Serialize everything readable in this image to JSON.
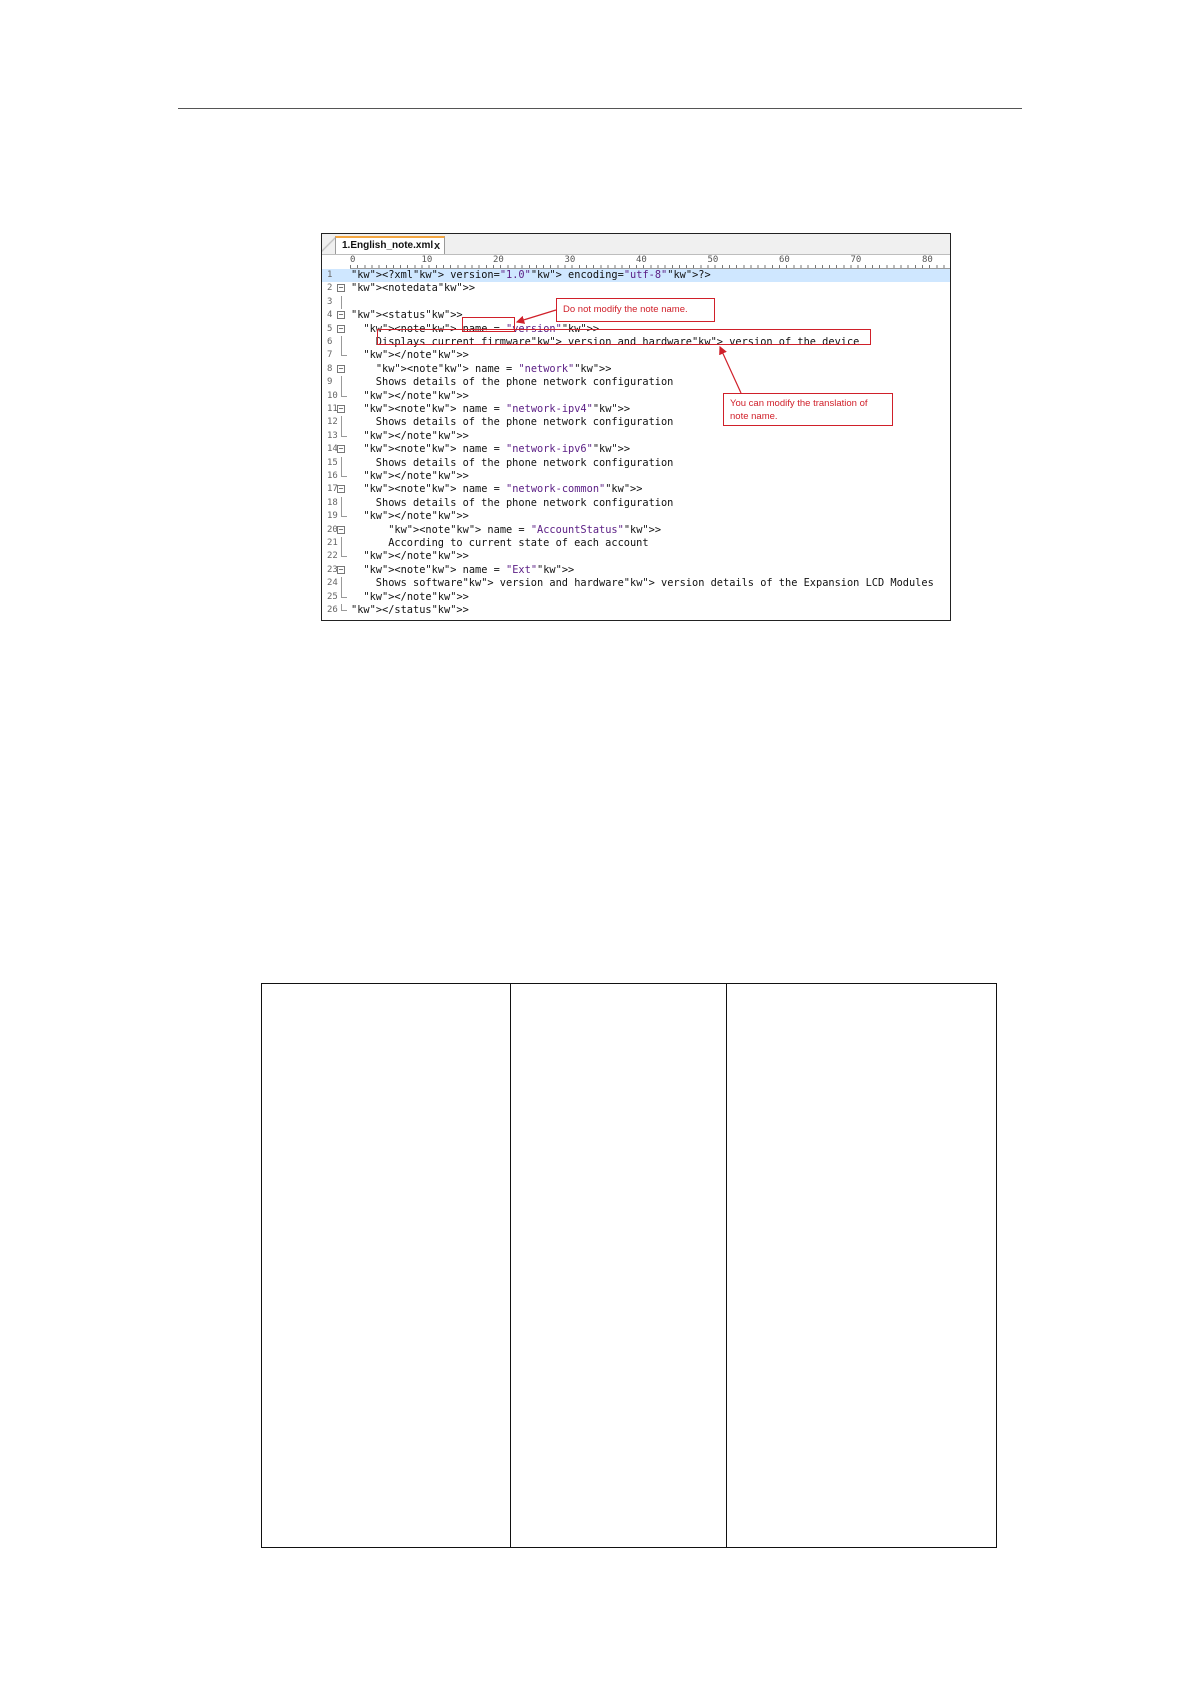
{
  "editor": {
    "tab_label": "1.English_note.xml",
    "tab_close": "x",
    "ruler_labels": [
      "0",
      "10",
      "20",
      "30",
      "40",
      "50",
      "60",
      "70",
      "80"
    ],
    "lines": [
      {
        "n": "1",
        "text": "<?xml version=\"1.0\" encoding=\"utf-8\"?>"
      },
      {
        "n": "2",
        "text": "<notedata>"
      },
      {
        "n": "3",
        "text": ""
      },
      {
        "n": "4",
        "text": "<status>"
      },
      {
        "n": "5",
        "text": "  <note name = \"version\">"
      },
      {
        "n": "6",
        "text": "    Displays current firmware version and hardware version of the device"
      },
      {
        "n": "7",
        "text": "  </note>"
      },
      {
        "n": "8",
        "text": "    <note name = \"network\">"
      },
      {
        "n": "9",
        "text": "    Shows details of the phone network configuration"
      },
      {
        "n": "10",
        "text": "  </note>"
      },
      {
        "n": "11",
        "text": "  <note name = \"network-ipv4\">"
      },
      {
        "n": "12",
        "text": "    Shows details of the phone network configuration"
      },
      {
        "n": "13",
        "text": "  </note>"
      },
      {
        "n": "14",
        "text": "  <note name = \"network-ipv6\">"
      },
      {
        "n": "15",
        "text": "    Shows details of the phone network configuration"
      },
      {
        "n": "16",
        "text": "  </note>"
      },
      {
        "n": "17",
        "text": "  <note name = \"network-common\">"
      },
      {
        "n": "18",
        "text": "    Shows details of the phone network configuration"
      },
      {
        "n": "19",
        "text": "  </note>"
      },
      {
        "n": "20",
        "text": "      <note name = \"AccountStatus\">"
      },
      {
        "n": "21",
        "text": "      According to current state of each account"
      },
      {
        "n": "22",
        "text": "  </note>"
      },
      {
        "n": "23",
        "text": "  <note name = \"Ext\">"
      },
      {
        "n": "24",
        "text": "    Shows software version and hardware version details of the Expansion LCD Modules"
      },
      {
        "n": "25",
        "text": "  </note>"
      },
      {
        "n": "26",
        "text": "</status>"
      }
    ]
  },
  "annotations": {
    "note_name": "Do not modify the note name.",
    "translation": "You can modify the translation of note name.",
    "color": "#d0202a"
  }
}
